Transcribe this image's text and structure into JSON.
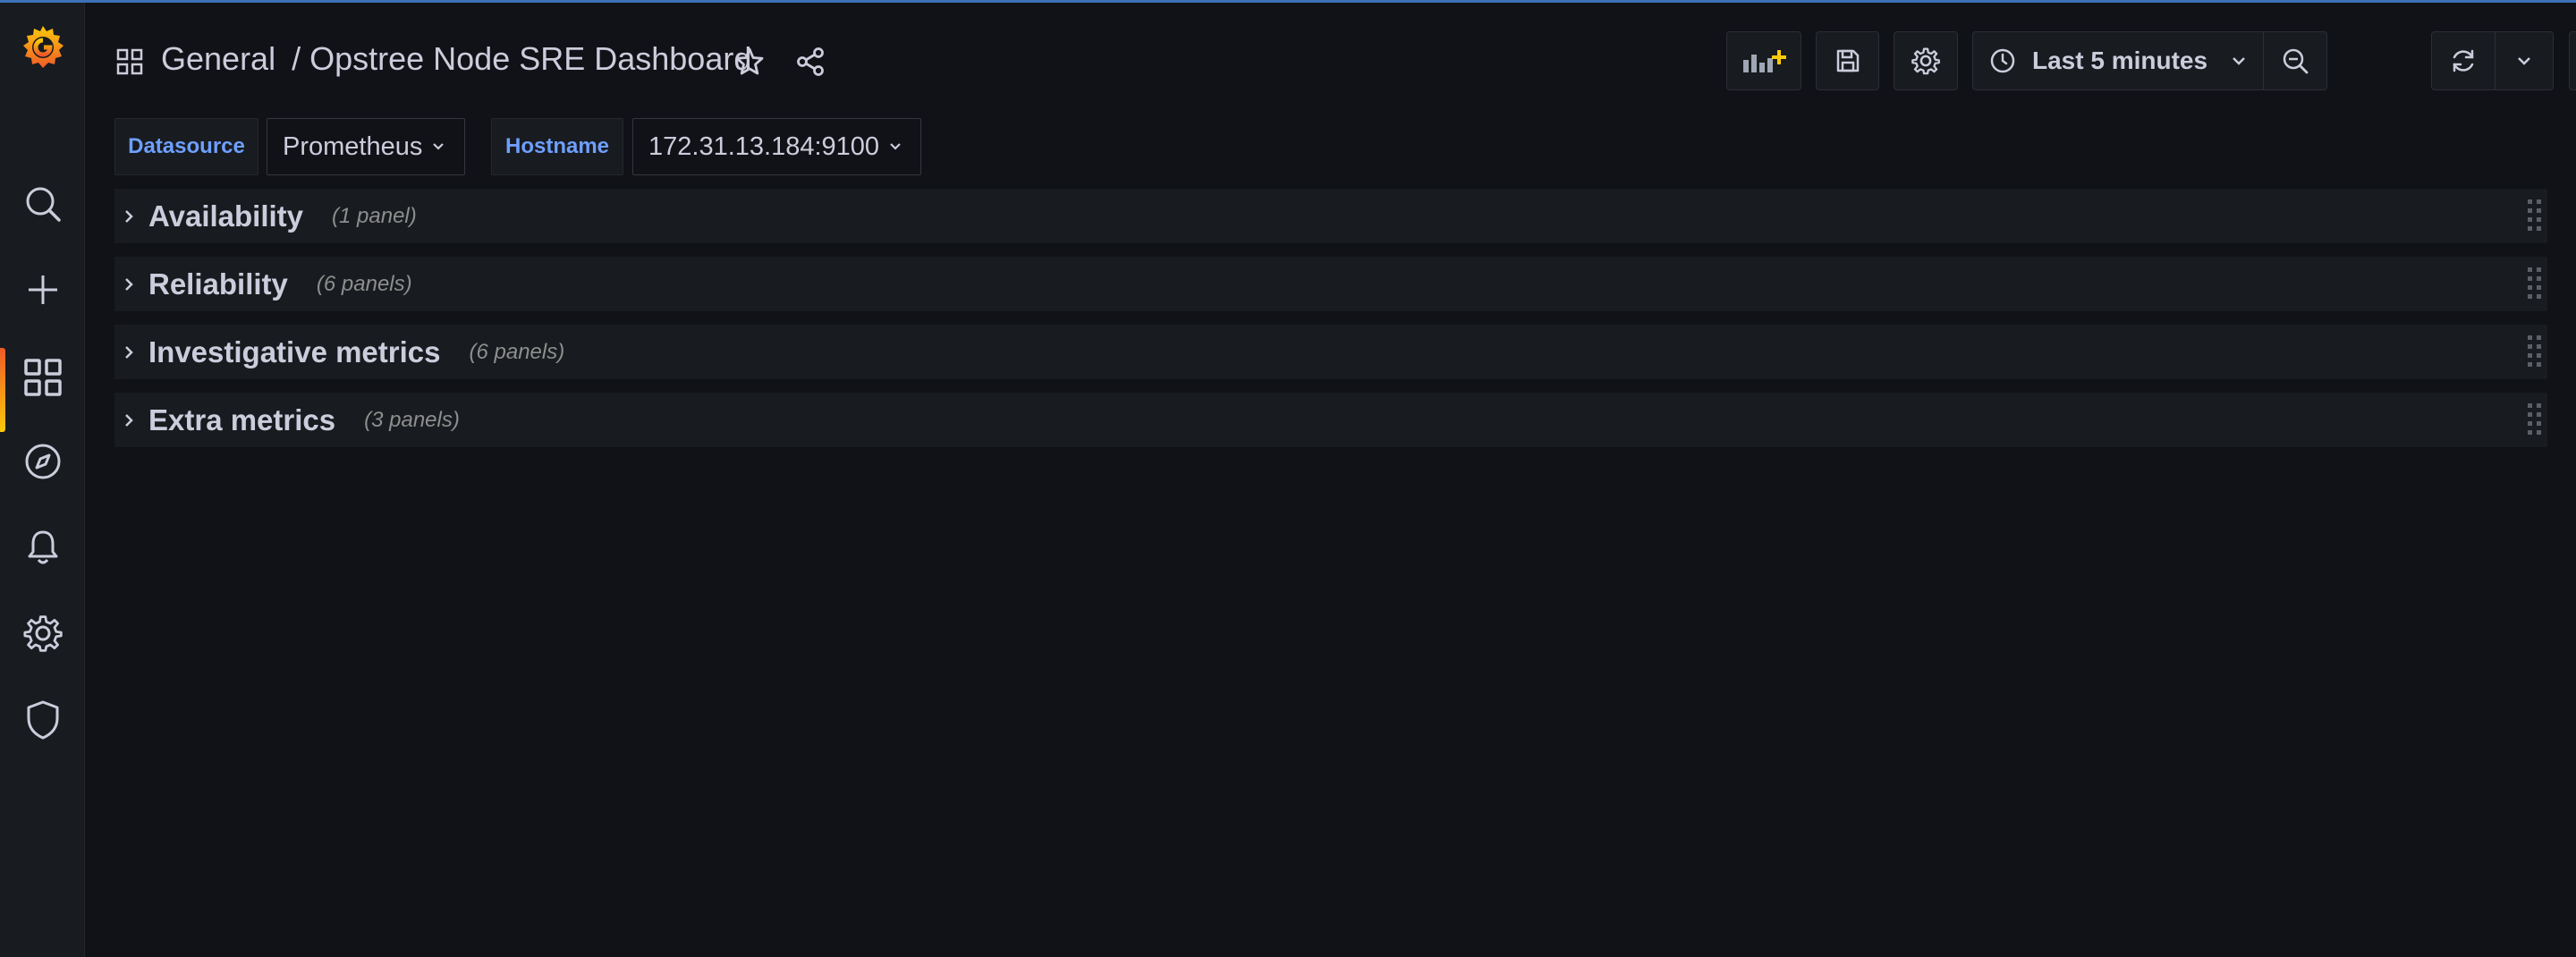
{
  "breadcrumb": {
    "folder": "General",
    "separator": "/",
    "dashboard": "Opstree Node SRE Dashboard"
  },
  "toolbar": {
    "time_range": "Last 5 minutes"
  },
  "variables": [
    {
      "label": "Datasource",
      "value": "Prometheus"
    },
    {
      "label": "Hostname",
      "value": "172.31.13.184:9100"
    }
  ],
  "rows": [
    {
      "title": "Availability",
      "count": "(1 panel)"
    },
    {
      "title": "Reliability",
      "count": "(6 panels)"
    },
    {
      "title": "Investigative metrics",
      "count": "(6 panels)"
    },
    {
      "title": "Extra metrics",
      "count": "(3 panels)"
    }
  ],
  "sidebar": {
    "items": [
      "grafana-logo",
      "search-icon",
      "plus-icon",
      "dashboards-icon",
      "explore-compass-icon",
      "alerting-bell-icon",
      "configuration-gear-icon",
      "server-admin-shield-icon"
    ],
    "active": "dashboards-icon"
  },
  "colors": {
    "background": "#111217",
    "panel": "#181b1f",
    "accent_blue": "#6e9fff",
    "add_panel_accent": "#fbca0a",
    "active_gradient_start": "#f05a28",
    "active_gradient_end": "#fbca0a"
  }
}
